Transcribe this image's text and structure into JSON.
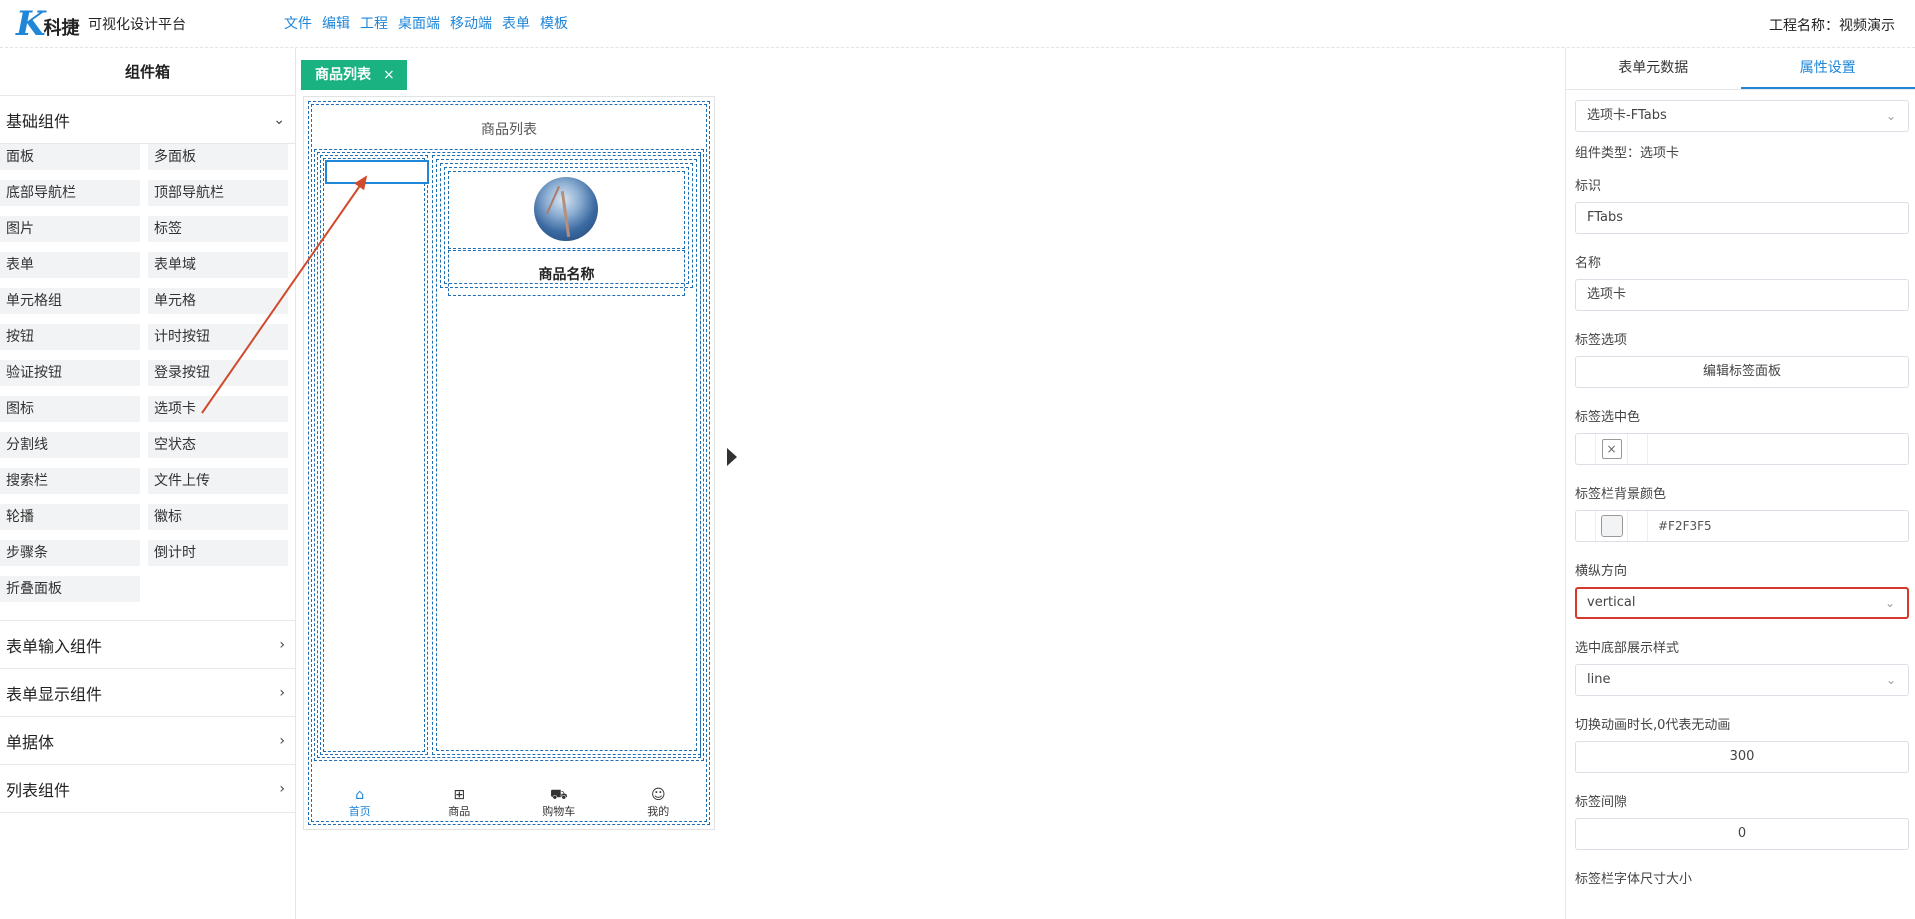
{
  "header": {
    "logo_letter": "K",
    "logo_name": "科捷",
    "platform": "可视化设计平台",
    "menu": [
      "文件",
      "编辑",
      "工程",
      "桌面端",
      "移动端",
      "表单",
      "模板"
    ],
    "project_label": "工程名称：视频演示"
  },
  "sidebar": {
    "title": "组件箱",
    "basic_group": "基础组件",
    "components": [
      "面板",
      "多面板",
      "底部导航栏",
      "顶部导航栏",
      "图片",
      "标签",
      "表单",
      "表单域",
      "单元格组",
      "单元格",
      "按钮",
      "计时按钮",
      "验证按钮",
      "登录按钮",
      "图标",
      "选项卡",
      "分割线",
      "空状态",
      "搜索栏",
      "文件上传",
      "轮播",
      "徽标",
      "步骤条",
      "倒计时",
      "折叠面板"
    ],
    "groups": [
      "表单输入组件",
      "表单显示组件",
      "单据体",
      "列表组件"
    ]
  },
  "canvas": {
    "tab_label": "商品列表",
    "tab_close": "×",
    "page_title": "商品列表",
    "product_name": "商品名称",
    "tabbar": [
      {
        "icon": "home-icon",
        "glyph": "⌂",
        "label": "首页"
      },
      {
        "icon": "goods-icon",
        "glyph": "⊞",
        "label": "商品"
      },
      {
        "icon": "cart-icon",
        "glyph": "⛟",
        "label": "购物车"
      },
      {
        "icon": "smile-icon",
        "glyph": "☺",
        "label": "我的"
      }
    ],
    "annotation_color": "#d04a2b"
  },
  "panel": {
    "tabs": [
      "表单元数据",
      "属性设置"
    ],
    "component_select": "选项卡-FTabs",
    "component_type": "组件类型：选项卡",
    "fields": {
      "id_label": "标识",
      "id_value": "FTabs",
      "name_label": "名称",
      "name_value": "选项卡",
      "tab_options_label": "标签选项",
      "tab_options_button": "编辑标签面板",
      "active_color_label": "标签选中色",
      "active_color_swatch": "×",
      "bar_bg_label": "标签栏背景颜色",
      "bar_bg_value": "#F2F3F5",
      "direction_label": "横纵方向",
      "direction_value": "vertical",
      "bottom_style_label": "选中底部展示样式",
      "bottom_style_value": "line",
      "anim_label": "切换动画时长,0代表无动画",
      "anim_value": "300",
      "gap_label": "标签间隙",
      "gap_value": "0",
      "font_size_label": "标签栏字体尺寸大小"
    }
  },
  "colors": {
    "accent": "#1f86d8",
    "tab_chip": "#1bb281",
    "highlight": "#d33a2c"
  }
}
